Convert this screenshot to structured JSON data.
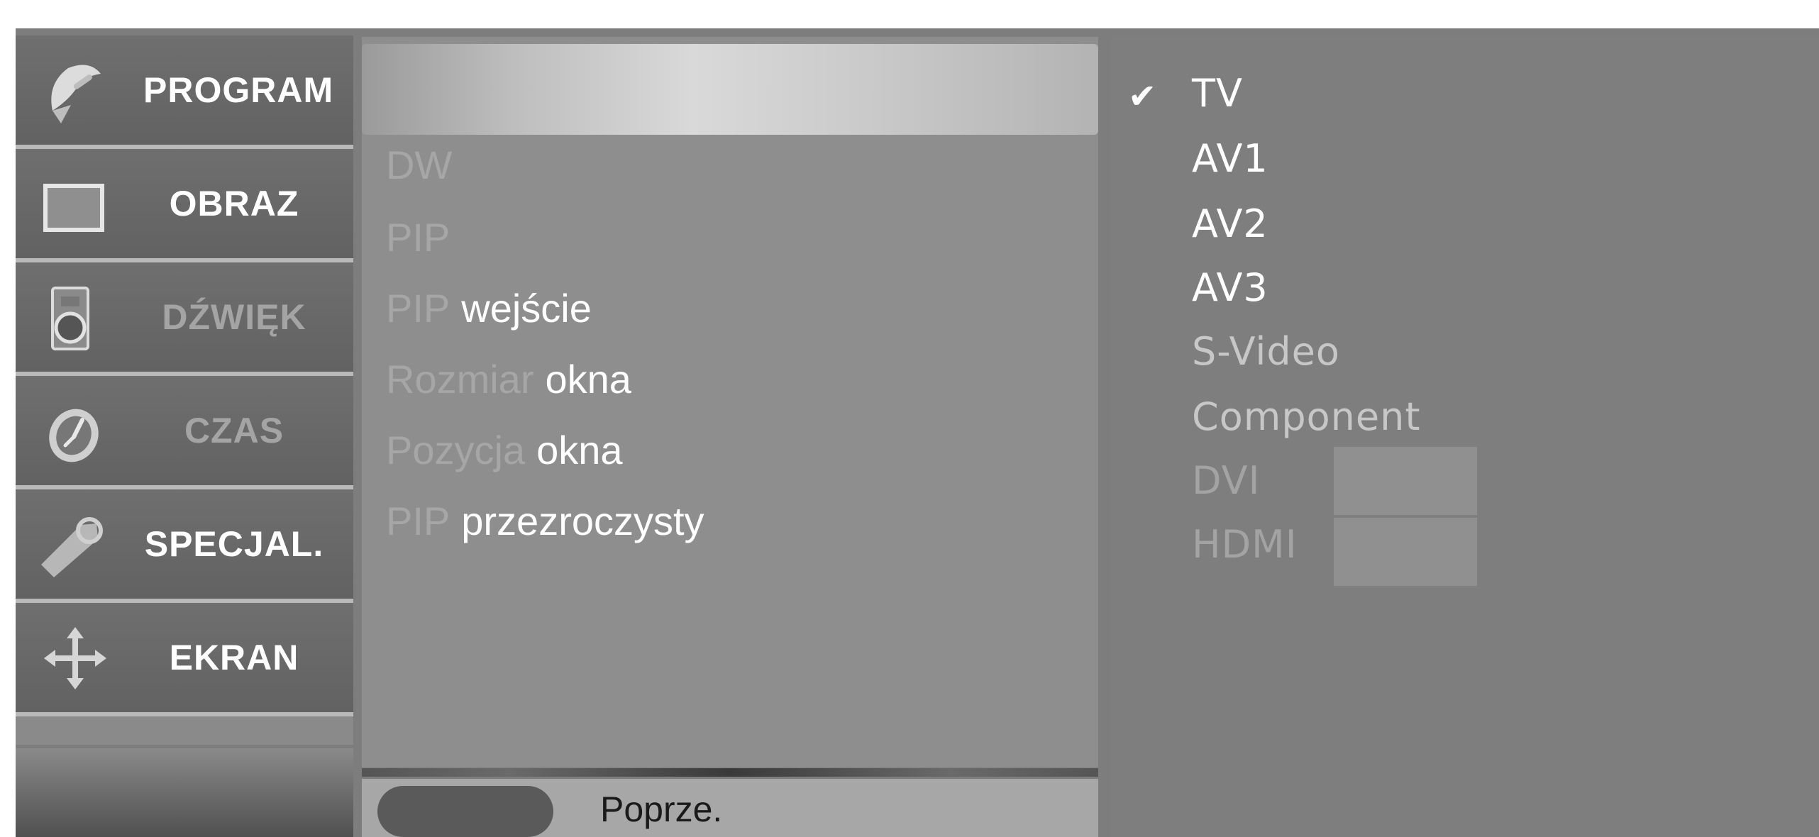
{
  "sidebar": {
    "items": [
      {
        "label": "PROGRAM",
        "icon": "satellite-dish-icon",
        "state": "active"
      },
      {
        "label": "OBRAZ",
        "icon": "picture-icon",
        "state": "normal"
      },
      {
        "label": "DŹWIĘK",
        "icon": "speaker-icon",
        "state": "dim"
      },
      {
        "label": "CZAS",
        "icon": "clock-icon",
        "state": "dim"
      },
      {
        "label": "SPECJAL.",
        "icon": "tag-icon",
        "state": "normal"
      },
      {
        "label": "EKRAN",
        "icon": "move-arrows-icon",
        "state": "normal"
      }
    ]
  },
  "submenu": {
    "items": [
      {
        "parts": [
          {
            "text": "DW",
            "dim": true
          }
        ]
      },
      {
        "parts": [
          {
            "text": "PIP",
            "dim": true
          }
        ]
      },
      {
        "parts": [
          {
            "text": "PIP",
            "dim": true
          },
          {
            "text": "wejście",
            "dim": false
          }
        ]
      },
      {
        "parts": [
          {
            "text": "Rozmiar",
            "dim": true
          },
          {
            "text": "okna",
            "dim": false
          }
        ]
      },
      {
        "parts": [
          {
            "text": "Pozycja",
            "dim": true
          },
          {
            "text": "okna",
            "dim": false
          }
        ]
      },
      {
        "parts": [
          {
            "text": "PIP",
            "dim": true
          },
          {
            "text": "przezroczysty",
            "dim": false
          }
        ]
      }
    ],
    "previous_label": "Poprze."
  },
  "sources": {
    "check_mark": "✔",
    "items": [
      {
        "label": "TV",
        "selected": true
      },
      {
        "label": "AV1",
        "selected": false
      },
      {
        "label": "AV2",
        "selected": false
      },
      {
        "label": "AV3",
        "selected": false
      },
      {
        "label": "S-Video",
        "selected": false
      },
      {
        "label": "Component",
        "selected": false
      },
      {
        "label": "DVI",
        "selected": false
      },
      {
        "label": "HDMI",
        "selected": false
      }
    ]
  },
  "colors": {
    "background": "#7e7e7e",
    "highlight": "#d9d9d9",
    "text_bright": "#ffffff",
    "text_dim": "#a6a6a6"
  }
}
